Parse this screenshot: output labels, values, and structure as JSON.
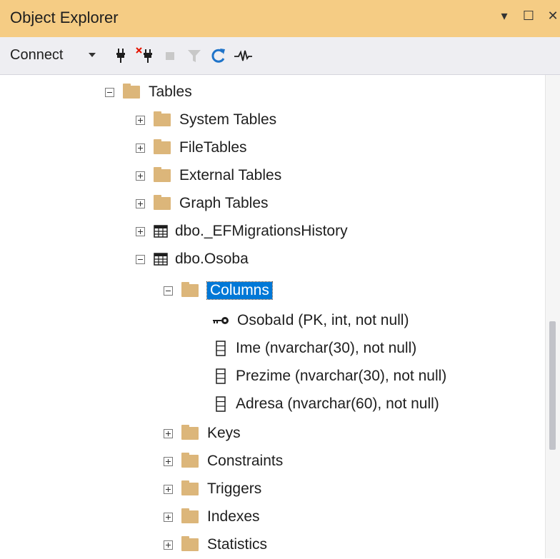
{
  "window": {
    "title": "Object Explorer"
  },
  "toolbar": {
    "connect_label": "Connect"
  },
  "tree": {
    "tables": "Tables",
    "system_tables": "System Tables",
    "file_tables": "FileTables",
    "external_tables": "External Tables",
    "graph_tables": "Graph Tables",
    "ef_migrations": "dbo._EFMigrationsHistory",
    "osoba": "dbo.Osoba",
    "columns": "Columns",
    "col_osobaid": "OsobaId (PK, int, not null)",
    "col_ime": "Ime (nvarchar(30), not null)",
    "col_prezime": "Prezime (nvarchar(30), not null)",
    "col_adresa": "Adresa (nvarchar(60), not null)",
    "keys": "Keys",
    "constraints": "Constraints",
    "triggers": "Triggers",
    "indexes": "Indexes",
    "statistics": "Statistics"
  },
  "colors": {
    "title_bar": "#f5cc84",
    "toolbar": "#eeeef2",
    "selection": "#0078d7",
    "folder": "#dcb67a"
  }
}
